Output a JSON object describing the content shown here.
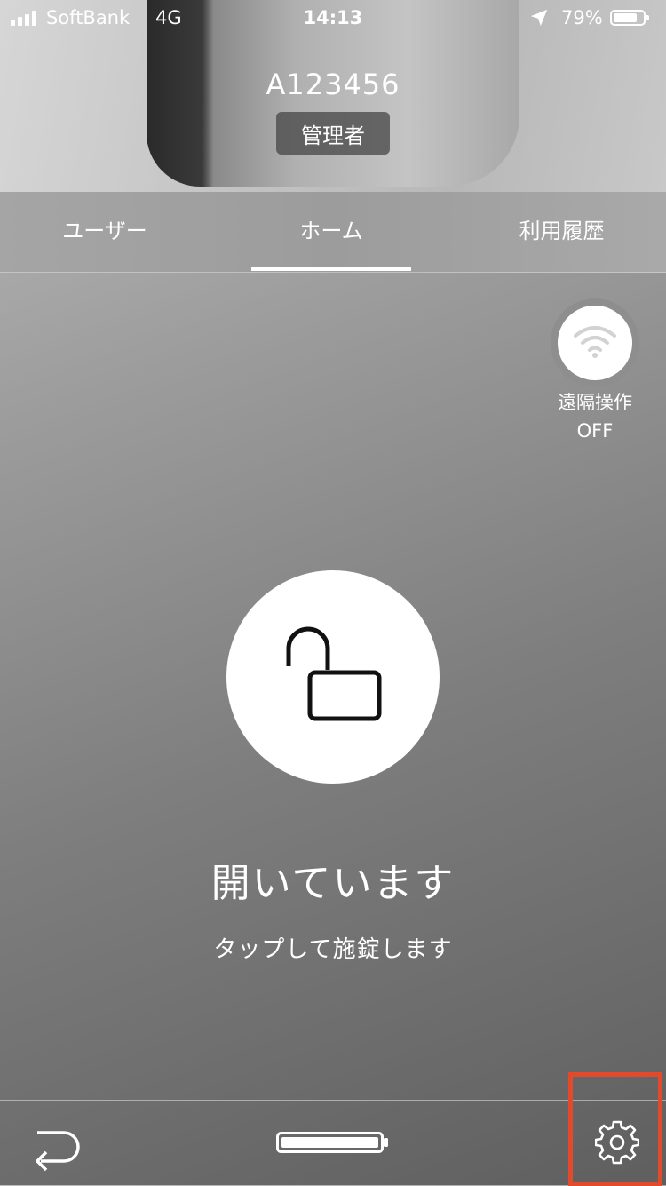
{
  "status_bar": {
    "carrier": "SoftBank",
    "network": "4G",
    "time": "14:13",
    "battery_percent": "79%"
  },
  "header": {
    "device_id": "A123456",
    "role": "管理者"
  },
  "tabs": [
    {
      "label": "ユーザー",
      "active": false
    },
    {
      "label": "ホーム",
      "active": true
    },
    {
      "label": "利用履歴",
      "active": false
    }
  ],
  "remote": {
    "label": "遠隔操作",
    "state": "OFF"
  },
  "lock": {
    "status": "開いています",
    "hint": "タップして施錠します"
  },
  "colors": {
    "highlight": "#e34a2b"
  },
  "icons": {
    "remote": "wifi-icon",
    "lock": "unlocked-padlock-icon",
    "back": "return-arrow-icon",
    "device_battery": "battery-icon",
    "settings": "gear-icon"
  }
}
